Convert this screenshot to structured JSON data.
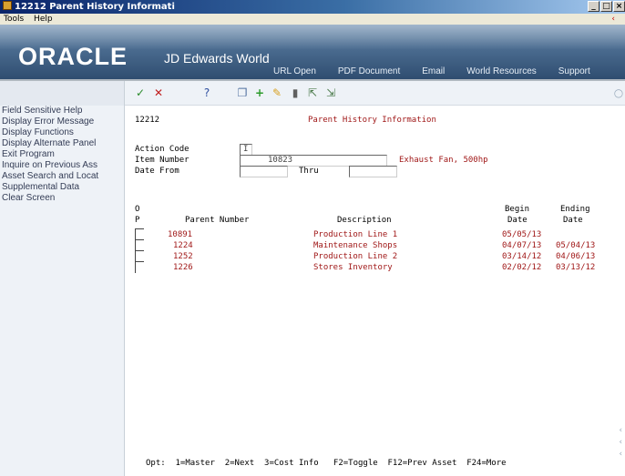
{
  "window": {
    "title": "12212   Parent History Informati"
  },
  "menubar": {
    "items": [
      "Tools",
      "Help"
    ]
  },
  "header": {
    "logo": "ORACLE",
    "product": "JD Edwards World",
    "links": [
      "URL Open",
      "PDF Document",
      "Email",
      "World Resources",
      "Support"
    ]
  },
  "leftpanel": {
    "items": [
      "Field Sensitive Help",
      "Display Error Message",
      "Display Functions",
      "Display Alternate Panel",
      "Exit Program",
      "Inquire on Previous Ass",
      "Asset Search and Locat",
      "Supplemental Data",
      "Clear Screen"
    ]
  },
  "toolbar": {
    "icons": [
      "ok-check-icon",
      "cancel-x-icon",
      "help-question-icon",
      "copy-icon",
      "add-plus-icon",
      "edit-pencil-icon",
      "delete-trash-icon",
      "export-icon",
      "import-icon"
    ]
  },
  "form": {
    "program_id": "12212",
    "title": "Parent History Information",
    "action_code": {
      "label": "Action Code",
      "value": "I"
    },
    "item_number": {
      "label": "Item Number",
      "value": "10823",
      "description": "Exhaust Fan, 500hp"
    },
    "date_from": {
      "label": "Date From",
      "value": "",
      "thru_label": "Thru",
      "thru_value": ""
    },
    "columns": {
      "o_top": "O",
      "o_bottom": "P",
      "parent_number": "Parent Number",
      "description": "Description",
      "begin_top": "Begin",
      "begin_bottom": "Date",
      "ending_top": "Ending",
      "ending_bottom": "Date"
    },
    "rows": [
      {
        "parent": "10891",
        "description": "Production Line 1",
        "begin": "05/05/13",
        "ending": ""
      },
      {
        "parent": "1224",
        "description": "Maintenance Shops",
        "begin": "04/07/13",
        "ending": "05/04/13"
      },
      {
        "parent": "1252",
        "description": "Production Line 2",
        "begin": "03/14/12",
        "ending": "04/06/13"
      },
      {
        "parent": "1226",
        "description": "Stores Inventory",
        "begin": "02/02/12",
        "ending": "03/13/12"
      }
    ],
    "options": "Opt:  1=Master  2=Next  3=Cost Info   F2=Toggle  F12=Prev Asset  F24=More"
  },
  "colors": {
    "accent_red": "#a01818",
    "header_blue": "#4a6b8f"
  }
}
